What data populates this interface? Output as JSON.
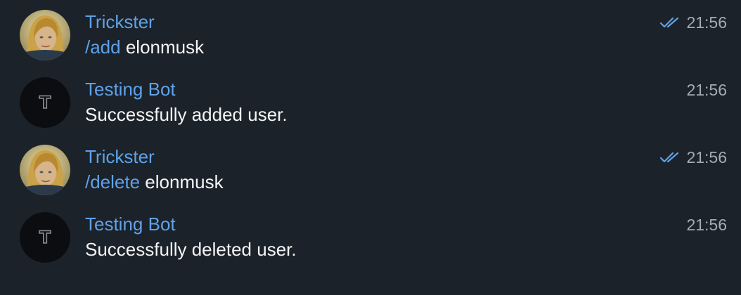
{
  "messages": [
    {
      "sender": "Trickster",
      "avatar": "user-photo-avatar",
      "command": "/add",
      "text": " elonmusk",
      "time": "21:56",
      "status_icon": "double-check-icon"
    },
    {
      "sender": "Testing Bot",
      "avatar": "bot-letter-t-avatar",
      "command": "",
      "text": "Successfully added user.",
      "time": "21:56"
    },
    {
      "sender": "Trickster",
      "avatar": "user-photo-avatar",
      "command": "/delete",
      "text": " elonmusk",
      "time": "21:56",
      "status_icon": "double-check-icon"
    },
    {
      "sender": "Testing Bot",
      "avatar": "bot-letter-t-avatar",
      "command": "",
      "text": "Successfully deleted user.",
      "time": "21:56"
    }
  ],
  "bot_avatar_letter": "T",
  "colors": {
    "background": "#1c222a",
    "sender": "#5ea2e8",
    "command": "#5ea2e8",
    "text": "#f4f5f6",
    "time": "#a3acb6",
    "check": "#5ea2e8",
    "bot_avatar_bg": "#0b0d10"
  }
}
